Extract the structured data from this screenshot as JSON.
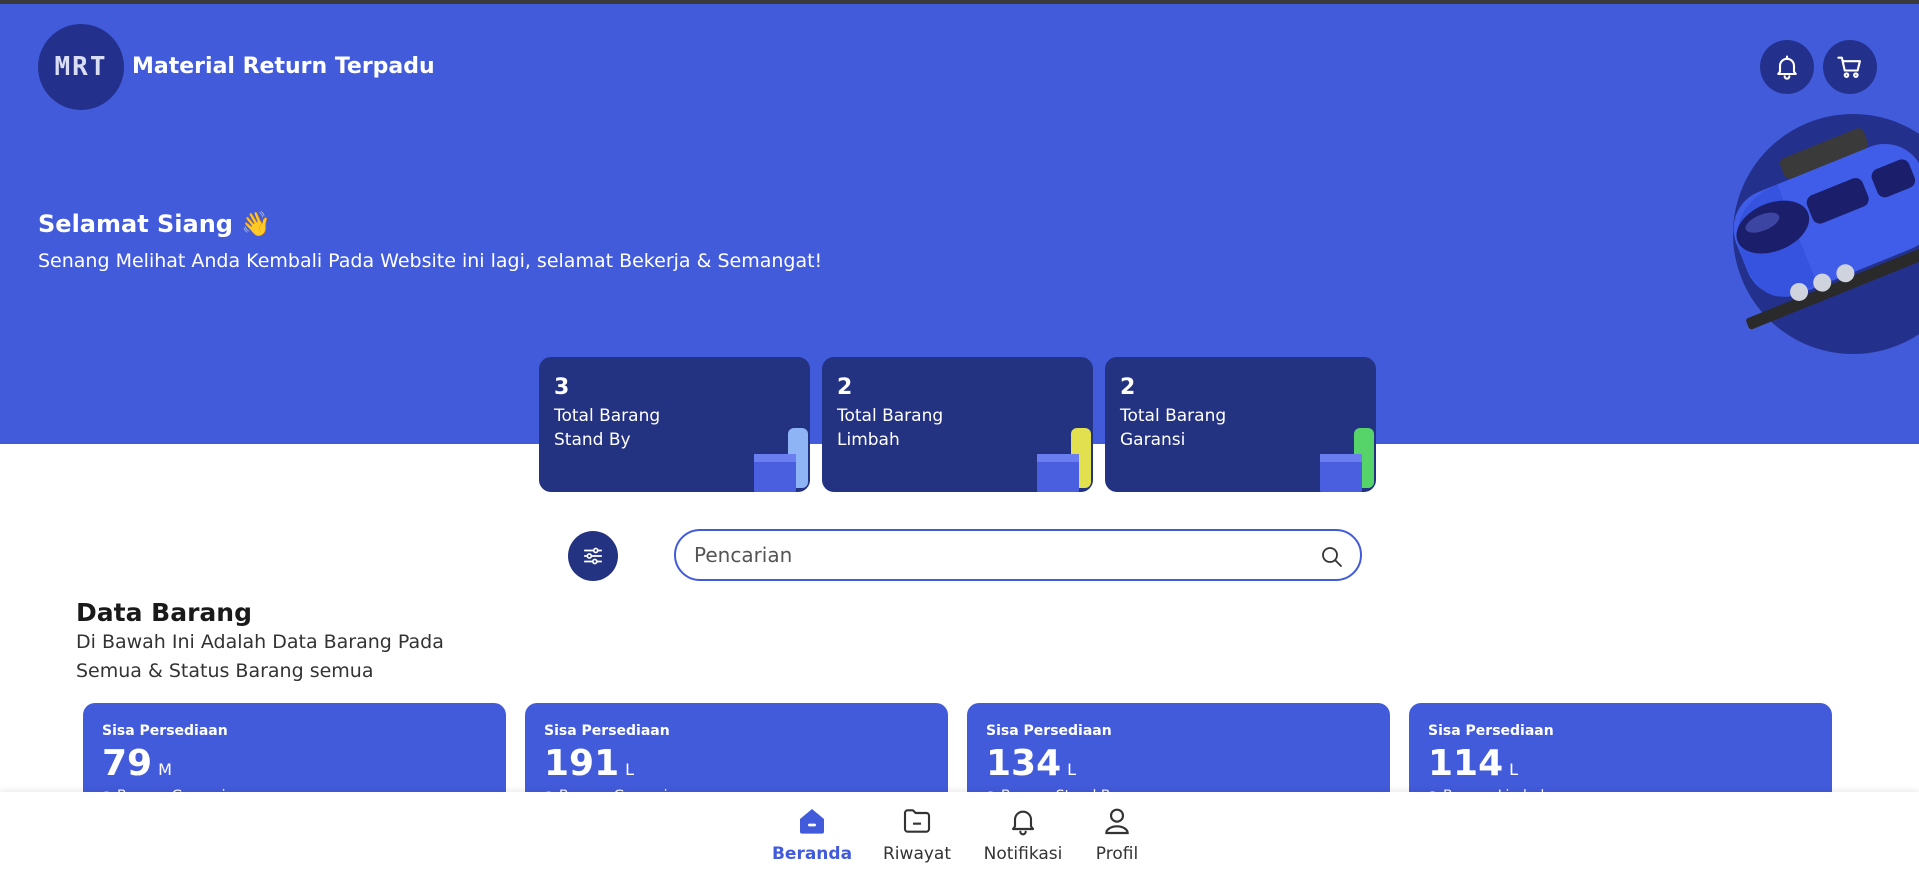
{
  "header": {
    "logo_text": "MRT",
    "app_title": "Material Return Terpadu",
    "notification_icon": "bell-icon",
    "cart_icon": "cart-icon"
  },
  "hero": {
    "greeting": "Selamat Siang 👋",
    "subtitle": "Senang Melihat Anda Kembali Pada Website ini lagi, selamat Bekerja & Semangat!",
    "background_color": "#425bdb",
    "card_color": "#243282"
  },
  "stats": [
    {
      "value": "3",
      "label": "Total Barang Stand By",
      "accent": "#8fb4f5"
    },
    {
      "value": "2",
      "label": "Total Barang Limbah",
      "accent": "#e3e04f"
    },
    {
      "value": "2",
      "label": "Total Barang Garansi",
      "accent": "#56d46a"
    }
  ],
  "search": {
    "placeholder": "Pencarian",
    "value": "",
    "filter_icon": "sliders-icon",
    "search_icon": "search-icon"
  },
  "section": {
    "title": "Data Barang",
    "description": "Di Bawah Ini Adalah Data Barang Pada Semua & Status Barang semua"
  },
  "items": [
    {
      "label": "Sisa Persediaan",
      "value": "79",
      "unit": "M",
      "status": "Barang Garansi",
      "status_color": "#56d46a"
    },
    {
      "label": "Sisa Persediaan",
      "value": "191",
      "unit": "L",
      "status": "Barang Garansi",
      "status_color": "#56d46a"
    },
    {
      "label": "Sisa Persediaan",
      "value": "134",
      "unit": "L",
      "status": "Barang Stand By",
      "status_color": "#8fb4f5"
    },
    {
      "label": "Sisa Persediaan",
      "value": "114",
      "unit": "L",
      "status": "Barang Limbah",
      "status_color": "#e3c24f"
    }
  ],
  "nav": [
    {
      "label": "Beranda",
      "icon": "home-icon",
      "active": true
    },
    {
      "label": "Riwayat",
      "icon": "history-icon",
      "active": false
    },
    {
      "label": "Notifikasi",
      "icon": "bell-icon",
      "active": false
    },
    {
      "label": "Profil",
      "icon": "user-icon",
      "active": false
    }
  ]
}
